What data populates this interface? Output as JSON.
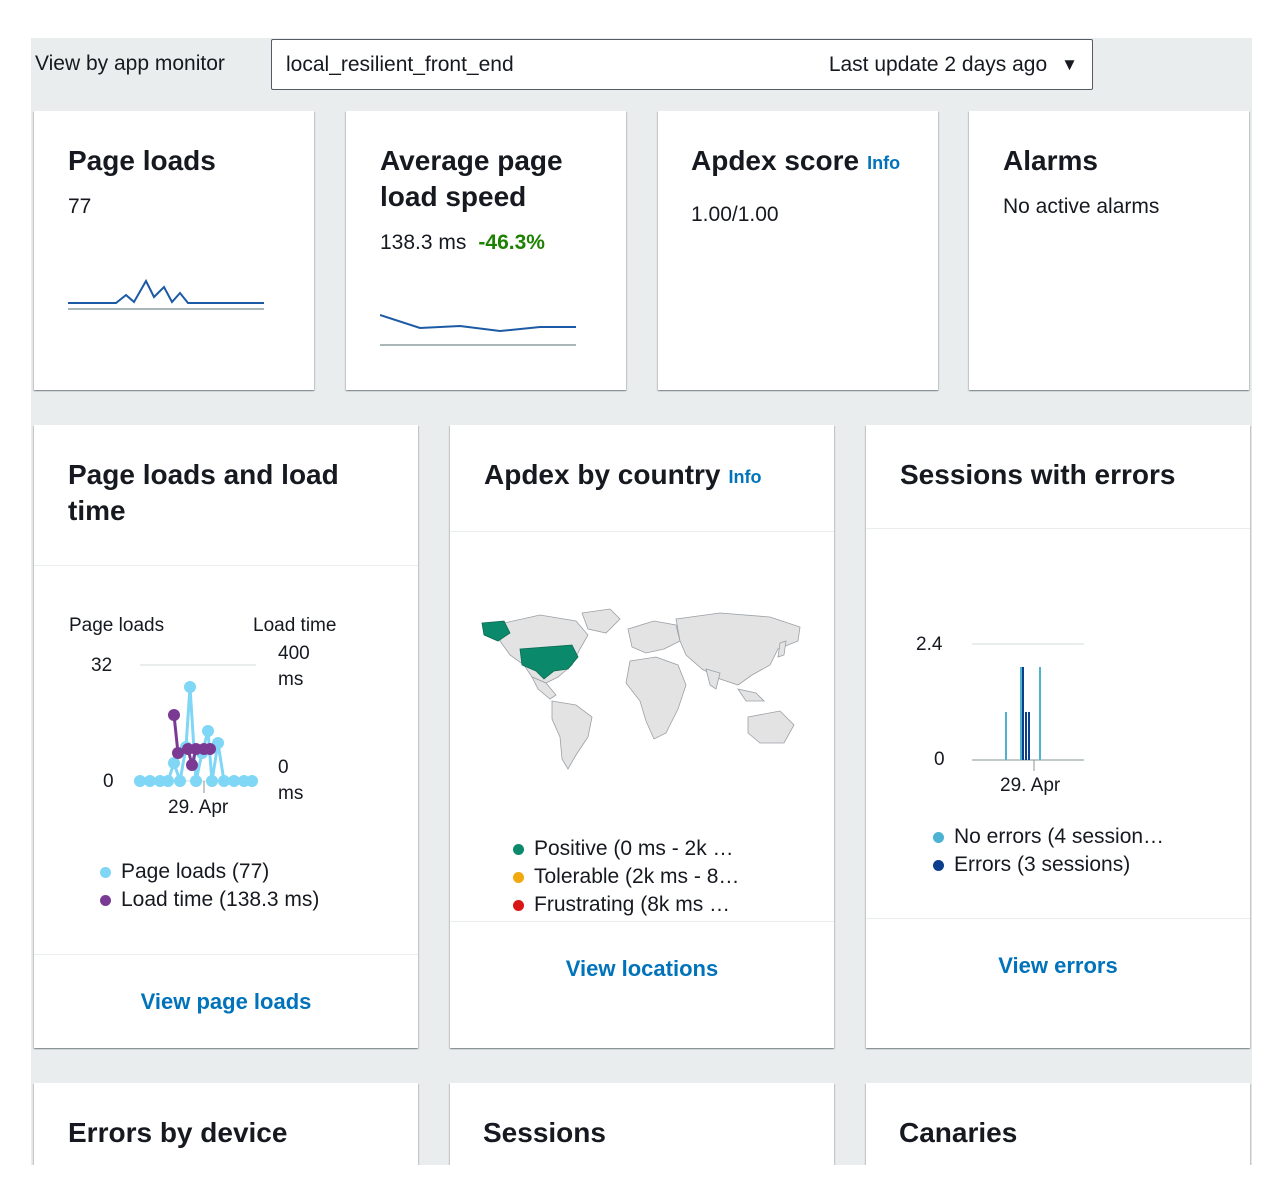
{
  "topbar": {
    "label": "View by app monitor",
    "monitor": "local_resilient_front_end",
    "last_update": "Last update 2 days ago"
  },
  "cards": {
    "page_loads": {
      "title": "Page loads",
      "value": "77"
    },
    "avg_speed": {
      "title_line1": "Average page",
      "title_line2": "load speed",
      "value": "138.3 ms",
      "change": "-46.3%"
    },
    "apdex": {
      "title": "Apdex score",
      "info": "Info",
      "value": "1.00/1.00"
    },
    "alarms": {
      "title": "Alarms",
      "value": "No active alarms"
    }
  },
  "widgets": {
    "load_time": {
      "title_line1": "Page loads and load",
      "title_line2": "time",
      "left_axis_label": "Page loads",
      "right_axis_label": "Load time",
      "left_ticks": [
        "32",
        "0"
      ],
      "right_ticks": [
        [
          "400",
          "ms"
        ],
        [
          "0",
          "ms"
        ]
      ],
      "x_tick": "29. Apr",
      "legend": [
        "Page loads (77)",
        "Load time (138.3 ms)"
      ],
      "link": "View page loads"
    },
    "apdex_country": {
      "title": "Apdex by country",
      "info": "Info",
      "legend": [
        "Positive (0 ms - 2k …",
        "Tolerable (2k ms - 8…",
        "Frustrating (8k ms …"
      ],
      "link": "View locations"
    },
    "sessions_errors": {
      "title": "Sessions with errors",
      "y_ticks": [
        "2.4",
        "0"
      ],
      "x_tick": "29. Apr",
      "legend": [
        "No errors (4 session…",
        "Errors (3 sessions)"
      ],
      "link": "View errors"
    }
  },
  "bottom_cards": [
    "Errors by device",
    "Sessions",
    "Canaries"
  ],
  "colors": {
    "link": "#0073bb",
    "positive": "#1d8102",
    "series_page_loads": "#7fd6f5",
    "series_load_time": "#7a3a94",
    "apdex_positive": "#0a8a6a",
    "apdex_tolerable": "#f2a80f",
    "apdex_frustrating": "#d91515",
    "no_errors": "#4eb3d3",
    "errors": "#0b3f8c",
    "sparkline": "#1c5aa6"
  },
  "icons": {
    "dropdown": "caret-down-icon",
    "map": "world-map"
  }
}
